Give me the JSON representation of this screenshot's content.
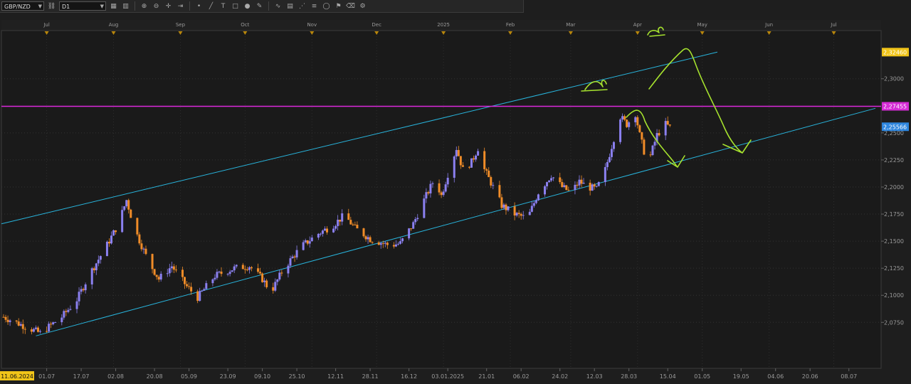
{
  "toolbar": {
    "symbol": "GBP/NZD",
    "timeframe": "D1",
    "icons": [
      "link-icon",
      "chart-type-icon",
      "bars-icon",
      "crosshair-icon",
      "zoom-in-icon",
      "zoom-out-icon",
      "autoscroll-icon",
      "dot-tool-icon",
      "line-tool-icon",
      "text-tool-icon",
      "shape-tool-icon",
      "color-icon",
      "pencil-icon",
      "indicator-icon",
      "template-icon",
      "objects-icon",
      "layers-icon",
      "circle-icon",
      "flag-icon",
      "eraser-icon",
      "settings-icon"
    ]
  },
  "colors": {
    "background": "#1e1e1e",
    "plot_border": "#3c3c3c",
    "bull": "#8b80f0",
    "bear": "#f08c28",
    "channel": "#28b4dc",
    "resistance": "#dc28dc",
    "drawing": "#a6e22e",
    "axis_text": "#9a9a9a",
    "month_marker": "#b8860b",
    "price_tag_top": "#f0c419",
    "price_tag_res": "#d52bd5",
    "price_tag_cur": "#2e86de",
    "date_tag": "#f0c419"
  },
  "chart_data": {
    "type": "candlestick",
    "symbol": "GBP/NZD",
    "timeframe": "D1",
    "ylim": [
      2.0325,
      2.3445
    ],
    "y_ticks": [
      "2,0750",
      "2,1000",
      "2,1250",
      "2,1500",
      "2,1750",
      "2,2000",
      "2,2250",
      "2,2500",
      "2,3000"
    ],
    "y_tick_values": [
      2.075,
      2.1,
      2.125,
      2.15,
      2.175,
      2.2,
      2.225,
      2.25,
      2.3
    ],
    "month_labels": [
      "Jul",
      "Aug",
      "Sep",
      "Oct",
      "Nov",
      "Dec",
      "2025",
      "Feb",
      "Mar",
      "Apr",
      "May",
      "Jun",
      "Jul"
    ],
    "month_dates": [
      "2024-07-01",
      "2024-08-01",
      "2024-09-01",
      "2024-10-01",
      "2024-11-01",
      "2024-12-01",
      "2025-01-01",
      "2025-02-01",
      "2025-03-01",
      "2025-04-01",
      "2025-05-01",
      "2025-06-01",
      "2025-07-01"
    ],
    "x_labels": [
      "11.06.2024",
      "01.07",
      "17.07",
      "02.08",
      "20.08",
      "05.09",
      "23.09",
      "09.10",
      "25.10",
      "12.11",
      "28.11",
      "16.12",
      "03.01.2025",
      "21.01",
      "06.02",
      "24.02",
      "12.03",
      "28.03",
      "15.04",
      "01.05",
      "19.05",
      "04.06",
      "20.06",
      "08.07"
    ],
    "x_dates": [
      "2024-06-11",
      "2024-07-01",
      "2024-07-17",
      "2024-08-02",
      "2024-08-20",
      "2024-09-05",
      "2024-09-23",
      "2024-10-09",
      "2024-10-25",
      "2024-11-12",
      "2024-11-28",
      "2024-12-16",
      "2025-01-03",
      "2025-01-21",
      "2025-02-06",
      "2025-02-24",
      "2025-03-12",
      "2025-03-28",
      "2025-04-15",
      "2025-05-01",
      "2025-05-19",
      "2025-06-04",
      "2025-06-20",
      "2025-07-08"
    ],
    "price_tags": [
      {
        "text": "2,32460",
        "value": 2.3246,
        "kind": "top"
      },
      {
        "text": "2,27455",
        "value": 2.27455,
        "kind": "resistance"
      },
      {
        "text": "2,25566",
        "value": 2.25566,
        "kind": "current"
      }
    ],
    "date_tag": "11.06.2024",
    "resistance": 2.27455,
    "channel": {
      "upper": [
        {
          "x": "2024-06-11",
          "y": 2.1665
        },
        {
          "x": "2025-05-08",
          "y": 2.3246
        }
      ],
      "lower": [
        {
          "x": "2024-06-26",
          "y": 2.0625
        },
        {
          "x": "2025-06-24",
          "y": 2.2585
        }
      ]
    },
    "closes": [
      {
        "x": "2024-06-11",
        "y": 2.08
      },
      {
        "x": "2024-06-28",
        "y": 2.065
      },
      {
        "x": "2024-07-08",
        "y": 2.08
      },
      {
        "x": "2024-07-15",
        "y": 2.096
      },
      {
        "x": "2024-07-21",
        "y": 2.12
      },
      {
        "x": "2024-07-28",
        "y": 2.143
      },
      {
        "x": "2024-08-03",
        "y": 2.165
      },
      {
        "x": "2024-08-07",
        "y": 2.188
      },
      {
        "x": "2024-08-11",
        "y": 2.16
      },
      {
        "x": "2024-08-17",
        "y": 2.132
      },
      {
        "x": "2024-08-22",
        "y": 2.115
      },
      {
        "x": "2024-08-28",
        "y": 2.127
      },
      {
        "x": "2024-09-04",
        "y": 2.108
      },
      {
        "x": "2024-09-09",
        "y": 2.098
      },
      {
        "x": "2024-09-17",
        "y": 2.118
      },
      {
        "x": "2024-09-26",
        "y": 2.125
      },
      {
        "x": "2024-10-03",
        "y": 2.127
      },
      {
        "x": "2024-10-09",
        "y": 2.115
      },
      {
        "x": "2024-10-13",
        "y": 2.103
      },
      {
        "x": "2024-10-19",
        "y": 2.125
      },
      {
        "x": "2024-10-27",
        "y": 2.145
      },
      {
        "x": "2024-11-04",
        "y": 2.157
      },
      {
        "x": "2024-11-11",
        "y": 2.165
      },
      {
        "x": "2024-11-16",
        "y": 2.174
      },
      {
        "x": "2024-11-21",
        "y": 2.162
      },
      {
        "x": "2024-11-28",
        "y": 2.152
      },
      {
        "x": "2024-12-07",
        "y": 2.146
      },
      {
        "x": "2024-12-12",
        "y": 2.148
      },
      {
        "x": "2024-12-18",
        "y": 2.166
      },
      {
        "x": "2024-12-23",
        "y": 2.188
      },
      {
        "x": "2024-12-28",
        "y": 2.208
      },
      {
        "x": "2024-12-31",
        "y": 2.192
      },
      {
        "x": "2025-01-03",
        "y": 2.212
      },
      {
        "x": "2025-01-07",
        "y": 2.236
      },
      {
        "x": "2025-01-10",
        "y": 2.216
      },
      {
        "x": "2025-01-14",
        "y": 2.223
      },
      {
        "x": "2025-01-17",
        "y": 2.236
      },
      {
        "x": "2025-01-20",
        "y": 2.216
      },
      {
        "x": "2025-01-24",
        "y": 2.2
      },
      {
        "x": "2025-01-28",
        "y": 2.183
      },
      {
        "x": "2025-02-03",
        "y": 2.175
      },
      {
        "x": "2025-02-09",
        "y": 2.171
      },
      {
        "x": "2025-02-14",
        "y": 2.195
      },
      {
        "x": "2025-02-20",
        "y": 2.211
      },
      {
        "x": "2025-02-25",
        "y": 2.2
      },
      {
        "x": "2025-03-01",
        "y": 2.195
      },
      {
        "x": "2025-03-05",
        "y": 2.205
      },
      {
        "x": "2025-03-09",
        "y": 2.2
      },
      {
        "x": "2025-03-13",
        "y": 2.198
      },
      {
        "x": "2025-03-17",
        "y": 2.216
      },
      {
        "x": "2025-03-21",
        "y": 2.245
      },
      {
        "x": "2025-03-24",
        "y": 2.265
      },
      {
        "x": "2025-03-27",
        "y": 2.258
      },
      {
        "x": "2025-03-31",
        "y": 2.268
      },
      {
        "x": "2025-04-02",
        "y": 2.248
      },
      {
        "x": "2025-04-04",
        "y": 2.233
      },
      {
        "x": "2025-04-07",
        "y": 2.229
      },
      {
        "x": "2025-04-10",
        "y": 2.248
      },
      {
        "x": "2025-04-14",
        "y": 2.258
      },
      {
        "x": "2025-04-16",
        "y": 2.255
      }
    ]
  }
}
